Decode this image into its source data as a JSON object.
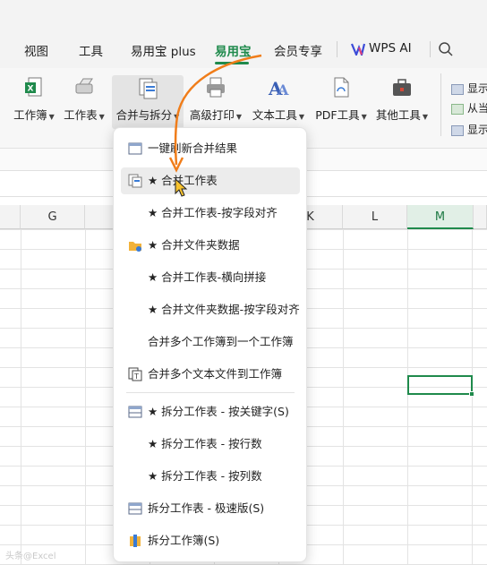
{
  "tabs": [
    "视图",
    "工具",
    "易用宝 plus",
    "易用宝",
    "会员专享",
    "WPS AI"
  ],
  "ribbon": [
    {
      "label": "工作簿",
      "icon": "excel-workbook-icon"
    },
    {
      "label": "工作表",
      "icon": "eraser-sheet-icon"
    },
    {
      "label": "合并与拆分",
      "icon": "merge-split-icon"
    },
    {
      "label": "高级打印",
      "icon": "printer-icon"
    },
    {
      "label": "文本工具",
      "icon": "text-tool-icon"
    },
    {
      "label": "PDF工具",
      "icon": "pdf-tool-icon"
    },
    {
      "label": "其他工具",
      "icon": "toolbox-icon"
    }
  ],
  "ribbon_right": [
    "显示",
    "从当",
    "显示"
  ],
  "columns": [
    "G",
    "K",
    "L",
    "M"
  ],
  "menu": [
    {
      "label": "一键刷新合并结果",
      "icon": "refresh-window-icon"
    },
    {
      "label": "★ 合并工作表",
      "icon": "merge-sheet-icon"
    },
    {
      "label": "★ 合并工作表-按字段对齐",
      "icon": ""
    },
    {
      "label": "★ 合并文件夹数据",
      "icon": "folder-icon"
    },
    {
      "label": "★ 合并工作表-横向拼接",
      "icon": ""
    },
    {
      "label": "★ 合并文件夹数据-按字段对齐",
      "icon": ""
    },
    {
      "label": "合并多个工作簿到一个工作簿",
      "icon": ""
    },
    {
      "label": "合并多个文本文件到工作簿",
      "icon": "text-file-merge-icon"
    },
    {
      "label": "★ 拆分工作表 - 按关键字(S)",
      "icon": "split-sheet-icon"
    },
    {
      "label": "★ 拆分工作表 - 按行数",
      "icon": ""
    },
    {
      "label": "★ 拆分工作表 - 按列数",
      "icon": ""
    },
    {
      "label": "拆分工作表 - 极速版(S)",
      "icon": "split-fast-icon"
    },
    {
      "label": "拆分工作簿(S)",
      "icon": "split-workbook-icon"
    }
  ],
  "watermark": "头条@Excel",
  "colors": {
    "accent": "#1f8a4c",
    "arrow": "#f07d1a"
  }
}
